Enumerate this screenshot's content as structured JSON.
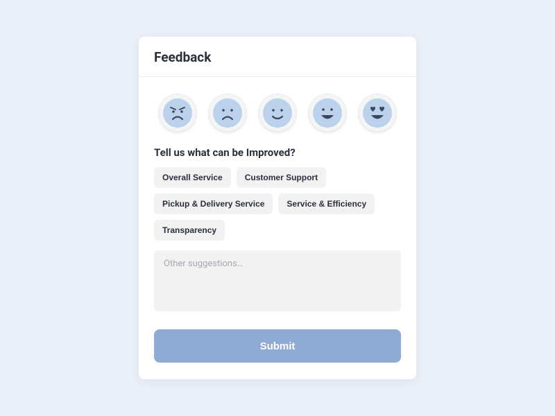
{
  "header": {
    "title": "Feedback"
  },
  "emojis": [
    {
      "name": "very-unhappy"
    },
    {
      "name": "unhappy"
    },
    {
      "name": "neutral-happy"
    },
    {
      "name": "happy"
    },
    {
      "name": "love"
    }
  ],
  "question": "Tell us what can be Improved?",
  "chips": [
    "Overall Service",
    "Customer Support",
    "Pickup & Delivery Service",
    "Service & Efficiency",
    "Transparency"
  ],
  "textarea": {
    "placeholder": "Other suggestions…"
  },
  "submit": "Submit"
}
